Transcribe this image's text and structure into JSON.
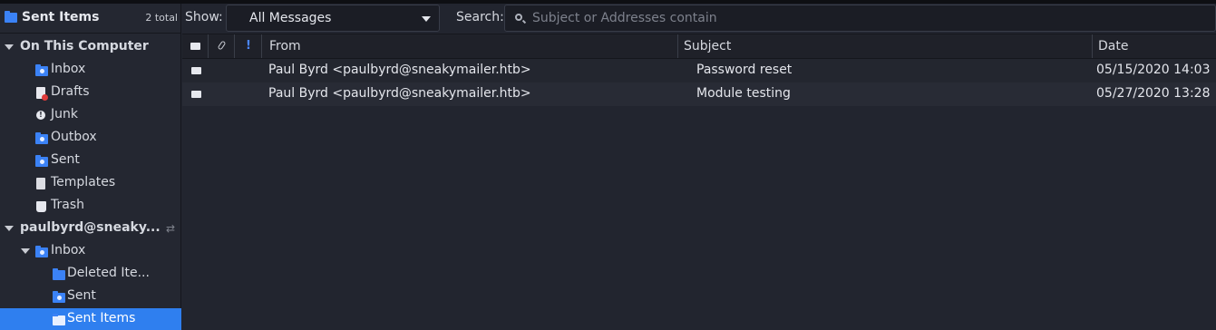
{
  "sidebar": {
    "header": {
      "title": "Sent Items",
      "count": "2 total"
    },
    "local": {
      "label": "On This Computer",
      "folders": [
        {
          "label": "Inbox",
          "icon": "inbox-folder-icon"
        },
        {
          "label": "Drafts",
          "icon": "drafts-icon"
        },
        {
          "label": "Junk",
          "icon": "junk-icon"
        },
        {
          "label": "Outbox",
          "icon": "outbox-folder-icon"
        },
        {
          "label": "Sent",
          "icon": "sent-folder-icon"
        },
        {
          "label": "Templates",
          "icon": "templates-icon"
        },
        {
          "label": "Trash",
          "icon": "trash-icon"
        }
      ]
    },
    "account": {
      "label": "paulbyrd@sneaky...",
      "inbox_label": "Inbox",
      "subfolders": [
        {
          "label": "Deleted Ite..."
        },
        {
          "label": "Sent"
        },
        {
          "label": "Sent Items",
          "selected": true
        }
      ]
    }
  },
  "toolbar": {
    "show_label": "Show:",
    "show_value": "All Messages",
    "search_label": "Search:",
    "search_placeholder": "Subject or Addresses contain"
  },
  "columns": {
    "from": "From",
    "subject": "Subject",
    "date": "Date"
  },
  "messages": [
    {
      "from": "Paul Byrd <paulbyrd@sneakymailer.htb>",
      "subject": "Password reset",
      "date": "05/15/2020 14:03"
    },
    {
      "from": "Paul Byrd <paulbyrd@sneakymailer.htb>",
      "subject": "Module testing",
      "date": "05/27/2020 13:28"
    }
  ],
  "colors": {
    "accent": "#2f7fef",
    "folder_blue": "#3b82f6",
    "important_flag": "#4a86ff"
  }
}
